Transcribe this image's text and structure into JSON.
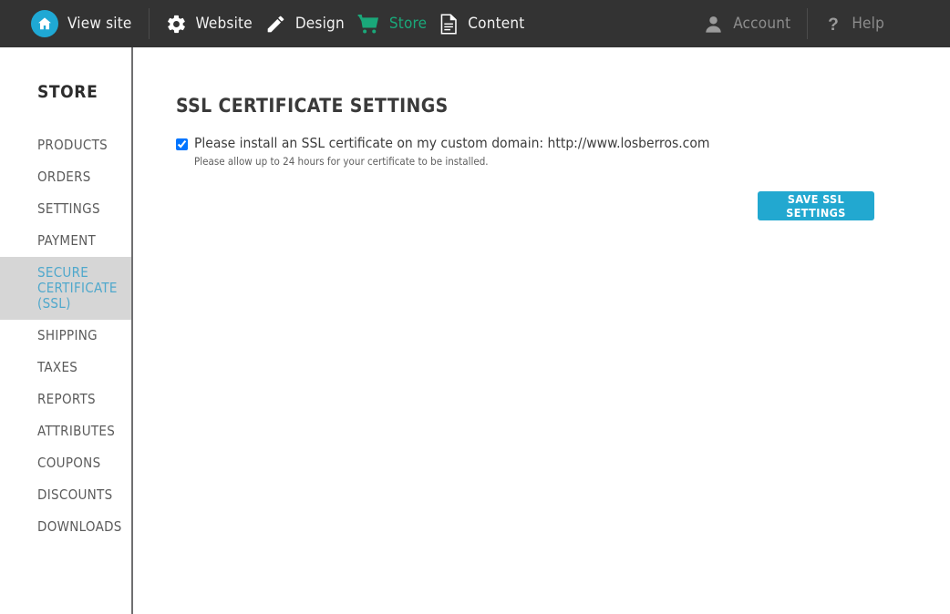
{
  "topbar": {
    "background_color": "#333333",
    "left_items": [
      {
        "label": "View site",
        "icon": "home-icon",
        "state": "normal"
      },
      {
        "label": "Website",
        "icon": "gear-icon",
        "state": "normal"
      },
      {
        "label": "Design",
        "icon": "pencil-icon",
        "state": "normal"
      },
      {
        "label": "Store",
        "icon": "shopping-cart-icon",
        "state": "active"
      },
      {
        "label": "Content",
        "icon": "document-icon",
        "state": "normal"
      }
    ],
    "right_items": [
      {
        "label": "Account",
        "icon": "user-icon",
        "state": "muted"
      },
      {
        "label": "Help",
        "icon": "question-mark-icon",
        "state": "muted"
      }
    ],
    "accent_colors": {
      "home_circle": "#1fa8d4",
      "store_active": "#1aa87a",
      "muted_text": "#8d8d8d"
    }
  },
  "sidebar": {
    "title": "STORE",
    "active_index": 4,
    "active_bg": "#d6d6d6",
    "active_text_color": "#4fa8cc",
    "items": [
      {
        "label": "PRODUCTS"
      },
      {
        "label": "ORDERS"
      },
      {
        "label": "SETTINGS"
      },
      {
        "label": "PAYMENT"
      },
      {
        "label": "SECURE CERTIFICATE (SSL)"
      },
      {
        "label": "SHIPPING"
      },
      {
        "label": "TAXES"
      },
      {
        "label": "REPORTS"
      },
      {
        "label": "ATTRIBUTES"
      },
      {
        "label": "COUPONS"
      },
      {
        "label": "DISCOUNTS"
      },
      {
        "label": "DOWNLOADS"
      }
    ]
  },
  "main": {
    "page_title": "SSL CERTIFICATE SETTINGS",
    "ssl": {
      "checked": true,
      "label": "Please install an SSL certificate on my custom domain: http://www.losberros.com",
      "domain": "http://www.losberros.com",
      "hint": "Please allow up to 24 hours for your certificate to be installed."
    },
    "save_button": {
      "label": "SAVE SSL SETTINGS",
      "color": "#22a8d0"
    }
  }
}
